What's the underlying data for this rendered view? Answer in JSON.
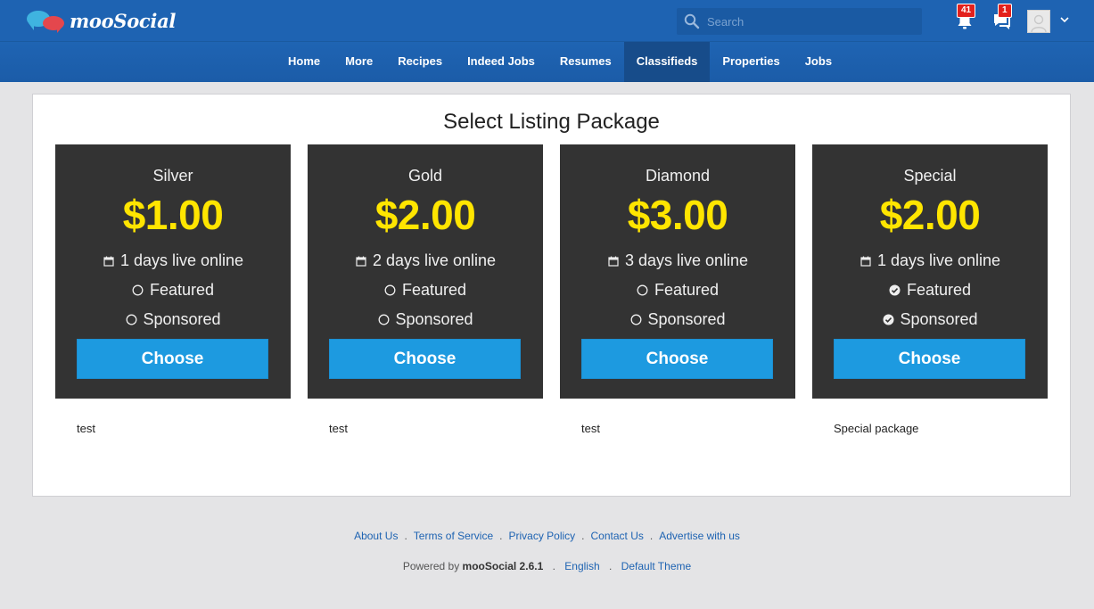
{
  "header": {
    "logo_text": "mooSocial",
    "search_placeholder": "Search",
    "notifications_count": "41",
    "messages_count": "1"
  },
  "nav": {
    "items": [
      "Home",
      "More",
      "Recipes",
      "Indeed Jobs",
      "Resumes",
      "Classifieds",
      "Properties",
      "Jobs"
    ],
    "active": "Classifieds"
  },
  "main": {
    "title": "Select Listing Package",
    "packages": [
      {
        "name": "Silver",
        "price": "$1.00",
        "duration": "1 days live online",
        "featured_label": "Featured",
        "featured": false,
        "sponsored_label": "Sponsored",
        "sponsored": false,
        "button": "Choose",
        "description": "test"
      },
      {
        "name": "Gold",
        "price": "$2.00",
        "duration": "2 days live online",
        "featured_label": "Featured",
        "featured": false,
        "sponsored_label": "Sponsored",
        "sponsored": false,
        "button": "Choose",
        "description": "test"
      },
      {
        "name": "Diamond",
        "price": "$3.00",
        "duration": "3 days live online",
        "featured_label": "Featured",
        "featured": false,
        "sponsored_label": "Sponsored",
        "sponsored": false,
        "button": "Choose",
        "description": "test"
      },
      {
        "name": "Special",
        "price": "$2.00",
        "duration": "1 days live online",
        "featured_label": "Featured",
        "featured": true,
        "sponsored_label": "Sponsored",
        "sponsored": true,
        "button": "Choose",
        "description": "Special package"
      }
    ]
  },
  "footer": {
    "links": [
      "About Us",
      "Terms of Service",
      "Privacy Policy",
      "Contact Us",
      "Advertise with us"
    ],
    "separator": ".",
    "powered_by": "Powered by",
    "brand_version": "mooSocial 2.6.1",
    "language": "English",
    "theme": "Default Theme"
  },
  "colors": {
    "header_bg": "#1e63b2",
    "nav_active_bg": "#174c8a",
    "card_bg": "#333333",
    "price": "#ffe500",
    "button": "#1d9ae0",
    "badge": "#e3211d",
    "page_bg": "#e4e4e6"
  },
  "icons": {
    "search": "search-icon",
    "notifications": "bell-icon",
    "messages": "chat-icon",
    "calendar": "calendar-icon",
    "unchecked": "circle-icon",
    "checked": "check-circle-icon",
    "caret": "chevron-down-icon"
  }
}
